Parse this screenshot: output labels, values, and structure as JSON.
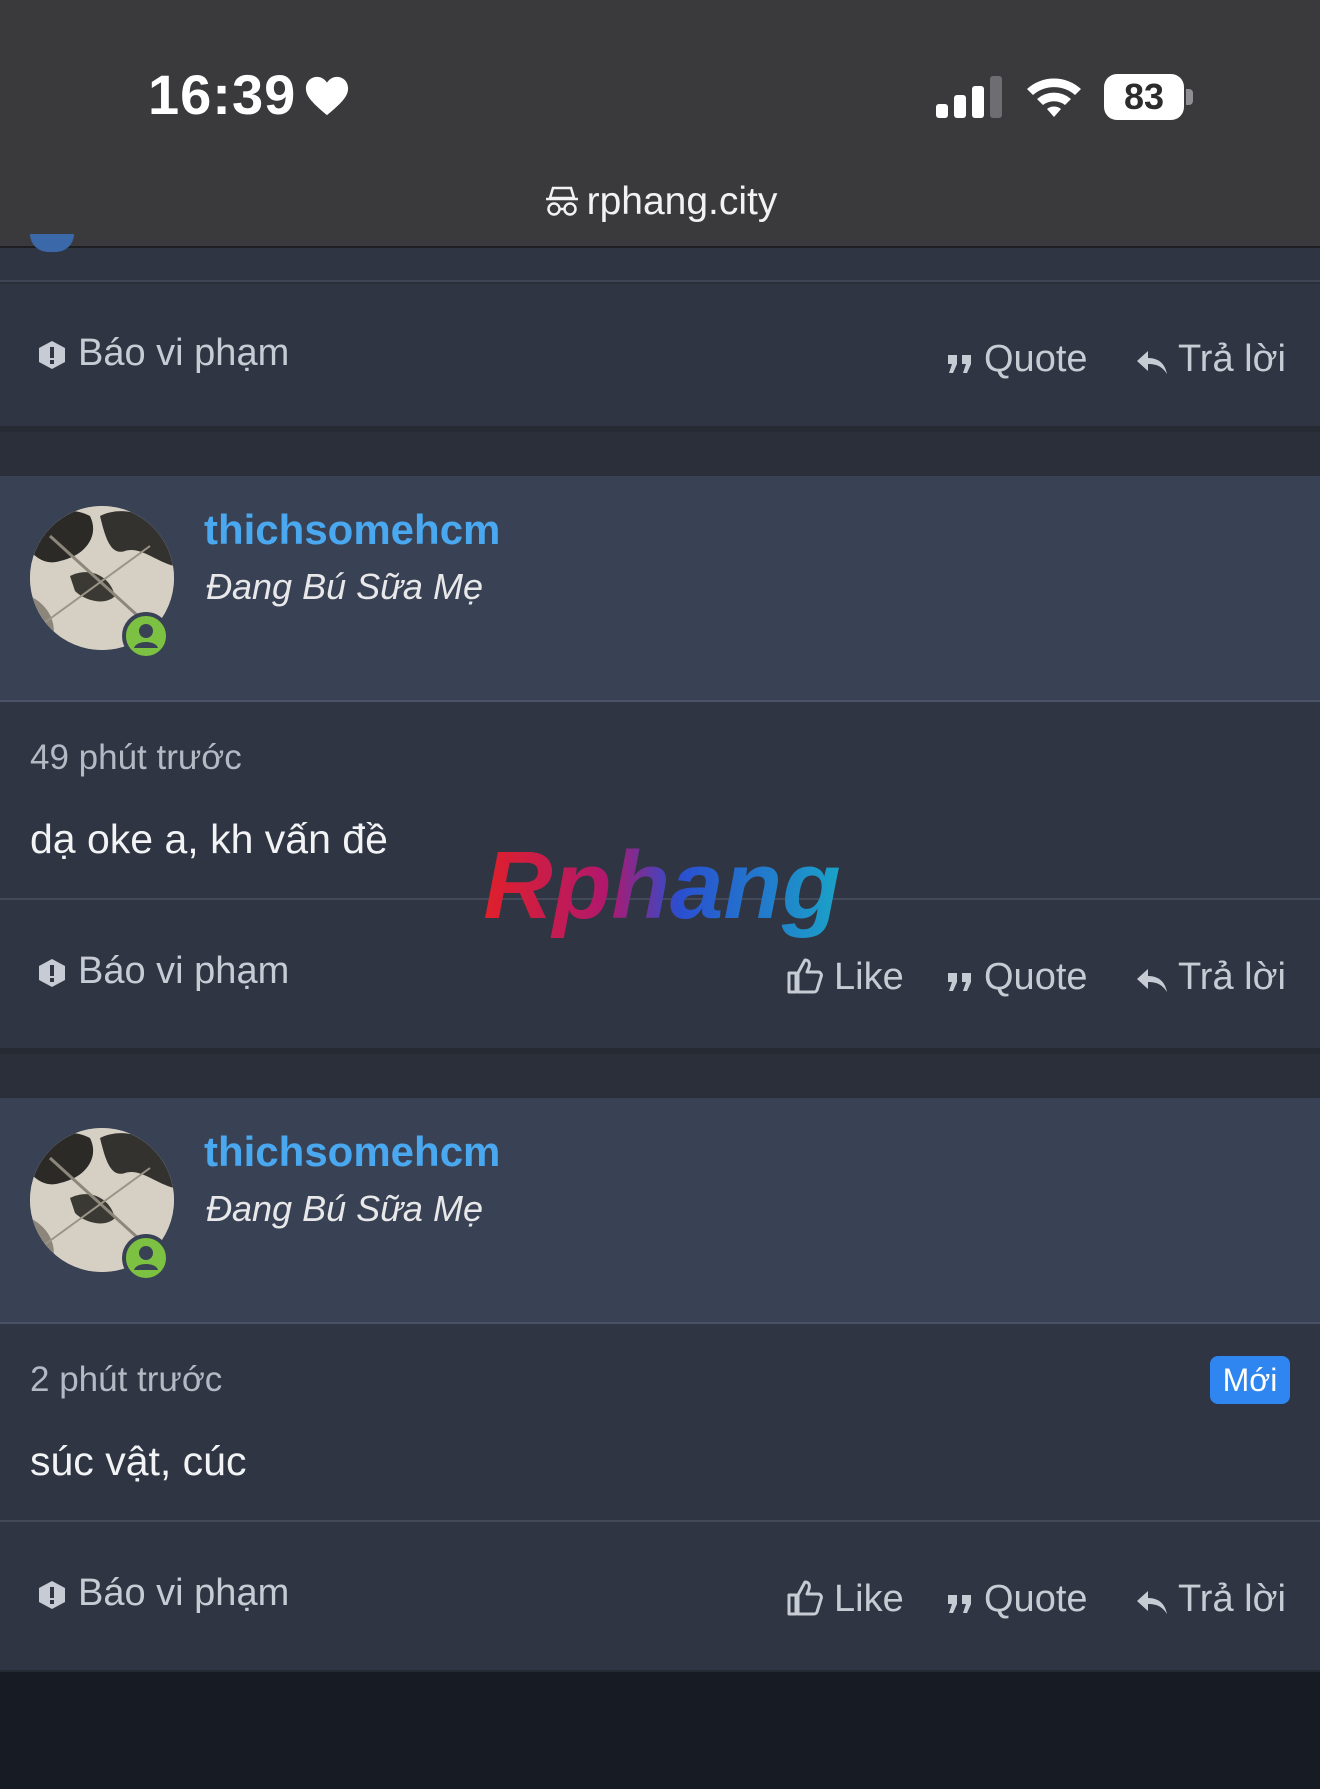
{
  "status_bar": {
    "time": "16:39",
    "battery": "83"
  },
  "address_bar": {
    "url": "rphang.city"
  },
  "watermark": {
    "text": "Rphang"
  },
  "actions": {
    "report": "Báo vi phạm",
    "like": "Like",
    "quote": "Quote",
    "reply": "Trả lời"
  },
  "posts": [
    {
      "username": "thichsomehcm",
      "user_title": "Đang Bú Sữa Mẹ",
      "time_ago": "49 phút trước",
      "message": "dạ oke a, kh vấn đề"
    },
    {
      "username": "thichsomehcm",
      "user_title": "Đang Bú Sữa Mẹ",
      "time_ago": "2 phút trước",
      "message": "súc vật, cúc",
      "badge": "Mới"
    }
  ],
  "colors": {
    "accent": "#4aa8f0",
    "online": "#7cc142",
    "badge": "#2f86f0",
    "background": "#2f3542"
  }
}
